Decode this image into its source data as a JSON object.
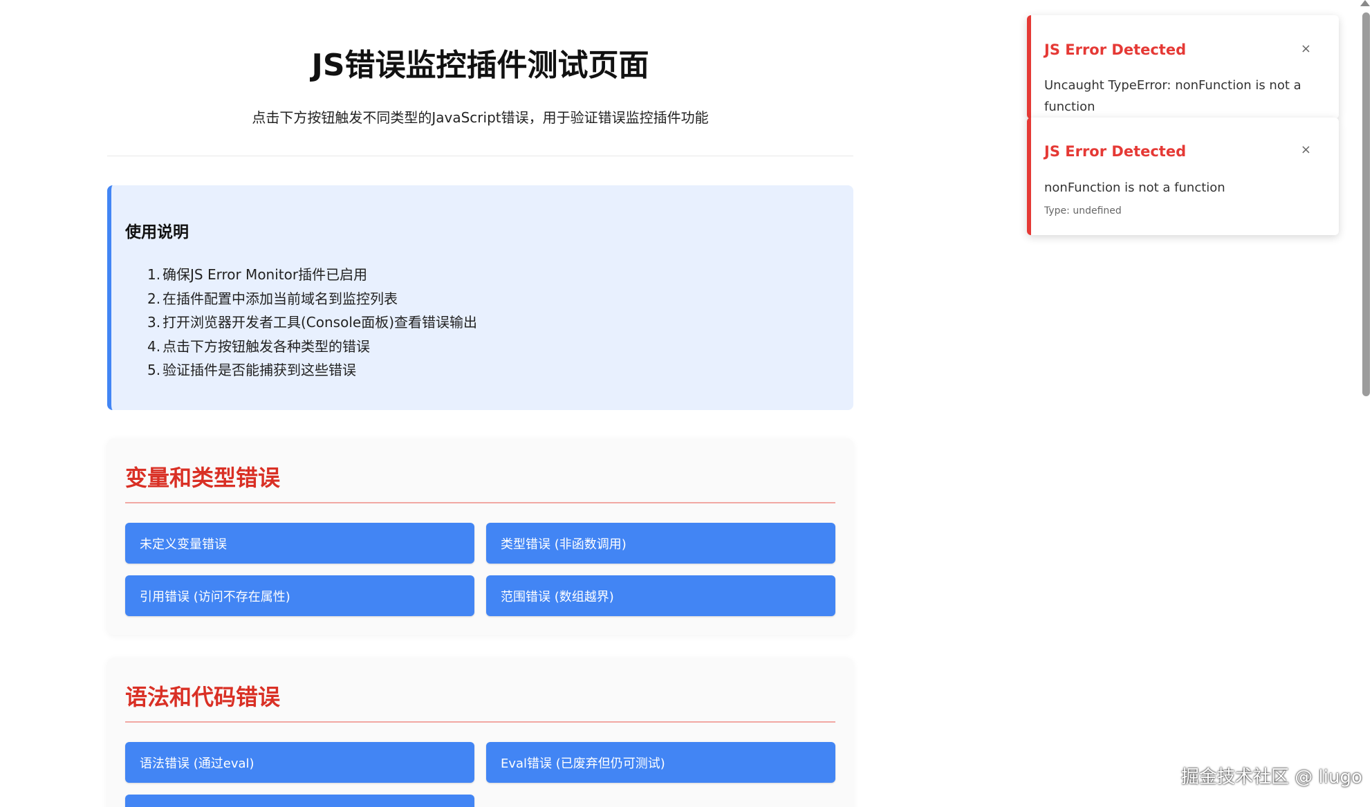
{
  "header": {
    "title": "JS错误监控插件测试页面",
    "subtitle": "点击下方按钮触发不同类型的JavaScript错误，用于验证错误监控插件功能"
  },
  "instructions": {
    "heading": "使用说明",
    "items": [
      {
        "num": "1.",
        "text": "确保JS Error Monitor插件已启用"
      },
      {
        "num": "2.",
        "text": "在插件配置中添加当前域名到监控列表"
      },
      {
        "num": "3.",
        "text": "打开浏览器开发者工具(Console面板)查看错误输出"
      },
      {
        "num": "4.",
        "text": "点击下方按钮触发各种类型的错误"
      },
      {
        "num": "5.",
        "text": "验证插件是否能捕获到这些错误"
      }
    ]
  },
  "sections": [
    {
      "title": "变量和类型错误",
      "buttons": [
        {
          "label": "未定义变量错误"
        },
        {
          "label": "类型错误 (非函数调用)"
        },
        {
          "label": "引用错误 (访问不存在属性)"
        },
        {
          "label": "范围错误 (数组越界)"
        }
      ]
    },
    {
      "title": "语法和代码错误",
      "buttons": [
        {
          "label": "语法错误 (通过eval)"
        },
        {
          "label": "Eval错误 (已废弃但仍可测试)"
        },
        {
          "label": ""
        }
      ]
    }
  ],
  "notifications": [
    {
      "title": "JS Error Detected",
      "message": "Uncaught TypeError: nonFunction is not a function",
      "close": "×"
    },
    {
      "title": "JS Error Detected",
      "message": "nonFunction is not a function",
      "type": "Type: undefined",
      "close": "×"
    }
  ],
  "watermark": "掘金技术社区 @ liugo",
  "colors": {
    "accent_blue": "#4285f4",
    "section_title_red": "#d93025",
    "toast_red": "#e53935",
    "info_bg": "#e8f0fe"
  }
}
